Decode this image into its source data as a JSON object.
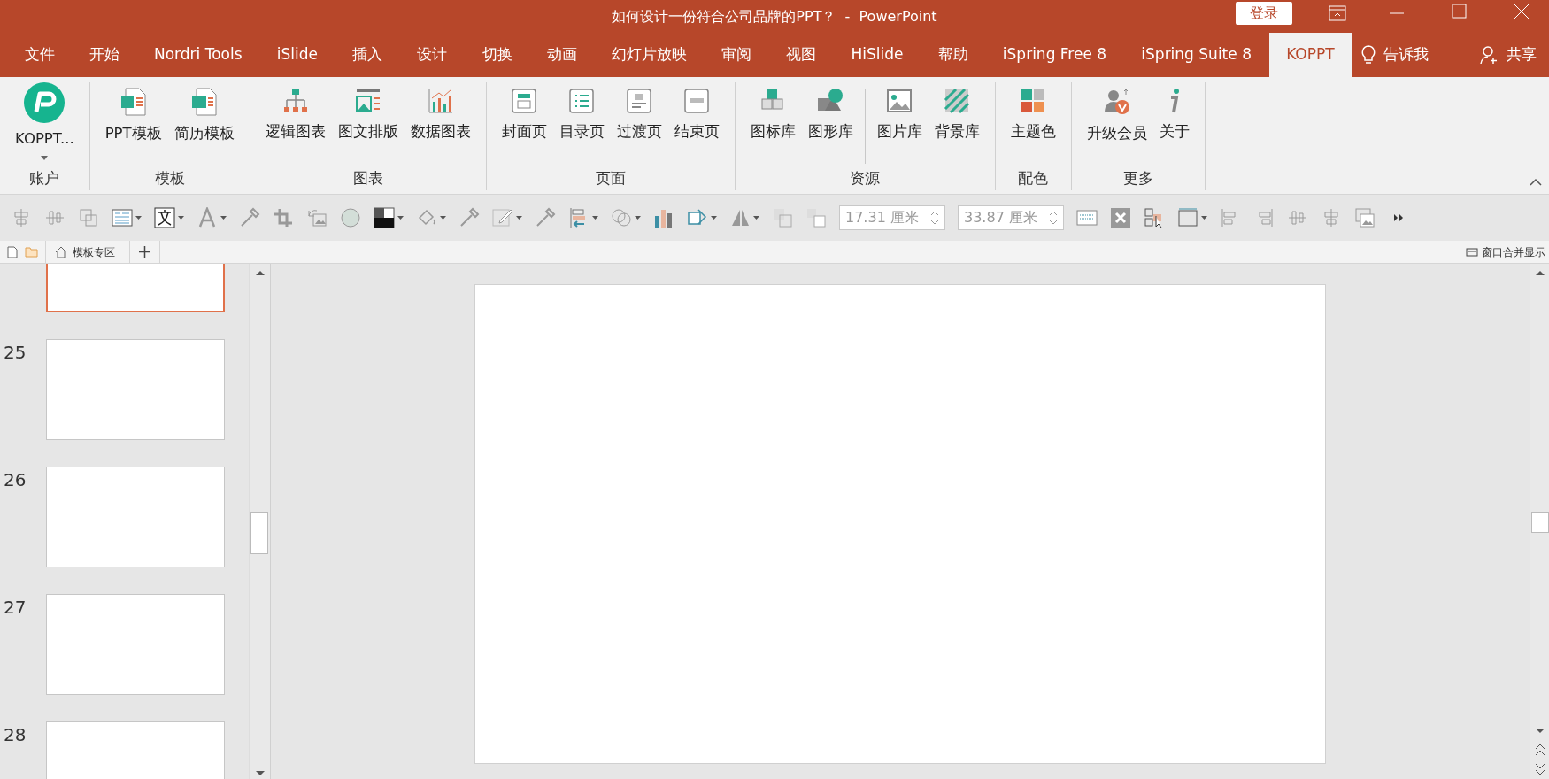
{
  "window": {
    "title": "如何设计一份符合公司品牌的PPT？  -  PowerPoint",
    "login_button": "登录"
  },
  "tabs": [
    {
      "label": "文件",
      "selected": false
    },
    {
      "label": "开始",
      "selected": false
    },
    {
      "label": "Nordri Tools",
      "selected": false
    },
    {
      "label": "iSlide",
      "selected": false
    },
    {
      "label": "插入",
      "selected": false
    },
    {
      "label": "设计",
      "selected": false
    },
    {
      "label": "切换",
      "selected": false
    },
    {
      "label": "动画",
      "selected": false
    },
    {
      "label": "幻灯片放映",
      "selected": false
    },
    {
      "label": "审阅",
      "selected": false
    },
    {
      "label": "视图",
      "selected": false
    },
    {
      "label": "HiSlide",
      "selected": false
    },
    {
      "label": "帮助",
      "selected": false
    },
    {
      "label": "iSpring Free 8",
      "selected": false
    },
    {
      "label": "iSpring Suite 8",
      "selected": false
    },
    {
      "label": "KOPPT",
      "selected": true
    }
  ],
  "tell_me": "告诉我",
  "share": "共享",
  "ribbon": {
    "groups": [
      {
        "label": "账户",
        "buttons": [
          {
            "label": "KOPPT...",
            "kind": "logo"
          }
        ]
      },
      {
        "label": "模板",
        "buttons": [
          {
            "label": "PPT模板",
            "kind": "ppt"
          },
          {
            "label": "简历模板",
            "kind": "cv"
          }
        ]
      },
      {
        "label": "图表",
        "buttons": [
          {
            "label": "逻辑图表",
            "kind": "org"
          },
          {
            "label": "图文排版",
            "kind": "imgtext"
          },
          {
            "label": "数据图表",
            "kind": "datachart"
          }
        ]
      },
      {
        "label": "页面",
        "buttons": [
          {
            "label": "封面页",
            "kind": "cover"
          },
          {
            "label": "目录页",
            "kind": "toc"
          },
          {
            "label": "过渡页",
            "kind": "transition"
          },
          {
            "label": "结束页",
            "kind": "end"
          }
        ]
      },
      {
        "label": "资源",
        "buttons": [
          {
            "label": "图标库",
            "kind": "cubes"
          },
          {
            "label": "图形库",
            "kind": "shapes"
          },
          {
            "label": "图片库",
            "kind": "picture",
            "separator_before": true
          },
          {
            "label": "背景库",
            "kind": "stripes"
          }
        ]
      },
      {
        "label": "配色",
        "buttons": [
          {
            "label": "主题色",
            "kind": "swatches"
          }
        ]
      },
      {
        "label": "更多",
        "buttons": [
          {
            "label": "升级会员",
            "kind": "member"
          },
          {
            "label": "关于",
            "kind": "info"
          }
        ]
      }
    ]
  },
  "size_fields": [
    {
      "value": "17.31 厘米"
    },
    {
      "value": "33.87 厘米"
    }
  ],
  "doc_tabs": [
    {
      "label": "模板专区"
    }
  ],
  "merge_window": "窗口合并显示",
  "slides": [
    {
      "selected": true
    },
    {
      "number": "25",
      "selected": false
    },
    {
      "number": "26",
      "selected": false
    },
    {
      "number": "27",
      "selected": false
    },
    {
      "number": "28",
      "selected": false
    }
  ]
}
